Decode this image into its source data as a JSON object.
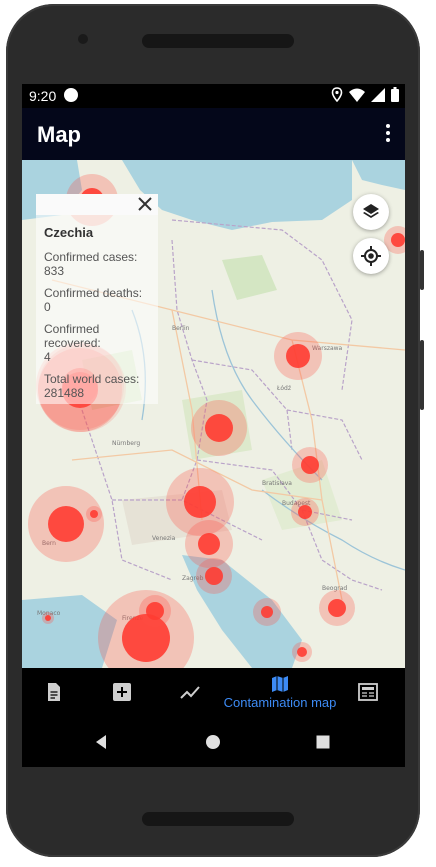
{
  "status_bar": {
    "time": "9:20"
  },
  "app_bar": {
    "title": "Map"
  },
  "info_panel": {
    "country": "Czechia",
    "confirmed_label": "Confirmed cases:",
    "confirmed_value": "833",
    "deaths_label": "Confirmed deaths:",
    "deaths_value": "0",
    "recovered_label": "Confirmed recovered:",
    "recovered_value": "4",
    "world_label": "Total world cases:",
    "world_value": "281488"
  },
  "bottom_nav": {
    "items": [
      {
        "icon": "document-icon",
        "label": ""
      },
      {
        "icon": "add-box-icon",
        "label": ""
      },
      {
        "icon": "trending-icon",
        "label": ""
      },
      {
        "icon": "map-icon",
        "label": "Contamination map",
        "active": true
      },
      {
        "icon": "news-icon",
        "label": ""
      }
    ]
  },
  "colors": {
    "accent": "#3d8bf5",
    "marker": "#ff3b2f",
    "app_bar": "#04071a",
    "sea": "#aad3df"
  }
}
